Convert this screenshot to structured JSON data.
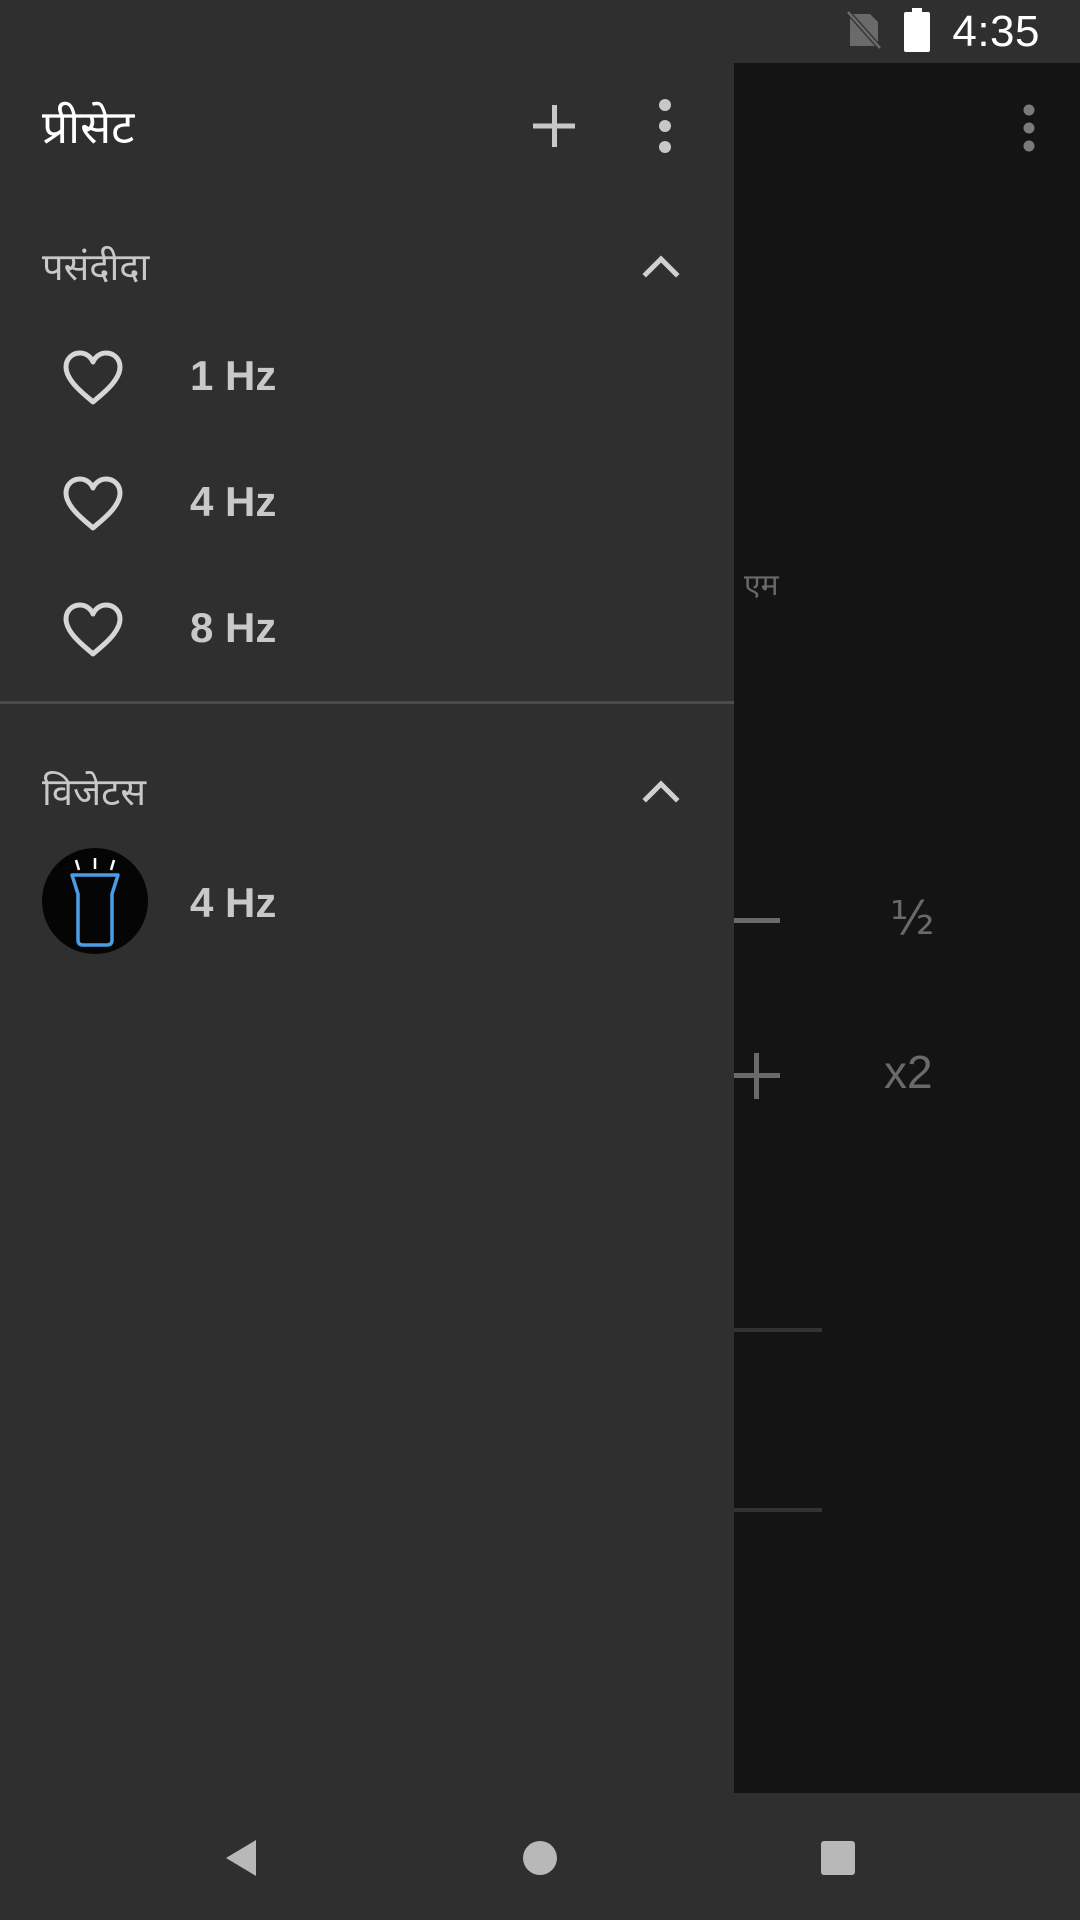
{
  "status_bar": {
    "time": "4:35",
    "icons": [
      "no-sim-icon",
      "battery-full-icon"
    ]
  },
  "background_app": {
    "partial_label": "एम",
    "half_label": "½",
    "double_label": "x2",
    "more_icon": "more-vert-icon"
  },
  "drawer": {
    "title": "प्रीसेट",
    "add_icon": "add-icon",
    "more_icon": "more-vert-icon",
    "favorites": {
      "title": "पसंदीदा",
      "expanded": true,
      "items": [
        {
          "label": "1 Hz",
          "icon": "heart-outline-icon"
        },
        {
          "label": "4 Hz",
          "icon": "heart-outline-icon"
        },
        {
          "label": "8 Hz",
          "icon": "heart-outline-icon"
        }
      ]
    },
    "widgets": {
      "title": "विजेटस",
      "expanded": true,
      "items": [
        {
          "label": "4 Hz",
          "icon": "flashlight-icon"
        }
      ]
    }
  },
  "nav_bar": {
    "buttons": [
      "back-icon",
      "home-icon",
      "recents-icon"
    ]
  },
  "colors": {
    "drawer_bg": "#2f2f2f",
    "app_bg": "#141414",
    "text_primary": "#ffffff",
    "text_secondary": "#c9c9c9",
    "accent_flashlight": "#4a9ee8"
  }
}
